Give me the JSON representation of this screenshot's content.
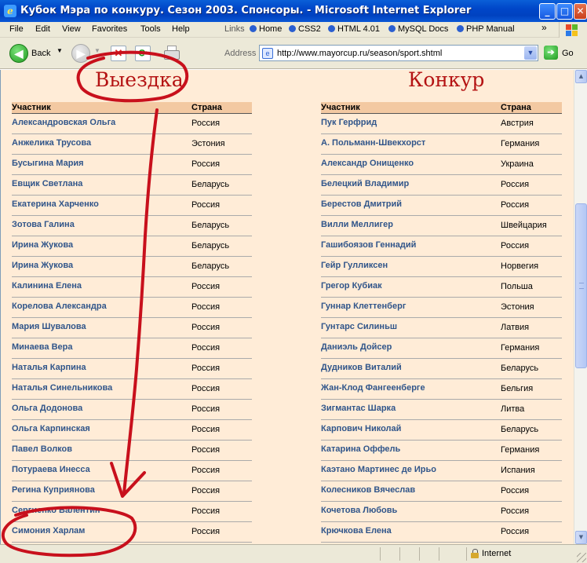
{
  "window": {
    "title": "Кубок Мэра по конкуру. Сезон 2003. Спонсоры. - Microsoft Internet Explorer"
  },
  "menubar": {
    "items": [
      "File",
      "Edit",
      "View",
      "Favorites",
      "Tools",
      "Help"
    ],
    "links_label": "Links",
    "links": [
      "Home",
      "CSS2",
      "HTML 4.01",
      "MySQL Docs",
      "PHP Manual"
    ]
  },
  "toolbar": {
    "back_label": "Back",
    "address_label": "Address",
    "address_value": "http://www.mayorcup.ru/season/sport.shtml",
    "go_label": "Go"
  },
  "icons": {
    "back": "back-arrow-icon",
    "forward": "forward-arrow-icon",
    "stop": "stop-icon",
    "refresh": "refresh-icon",
    "print": "printer-icon",
    "go": "go-arrow-icon",
    "zone": "lock-icon"
  },
  "colors": {
    "page_background": "#ffecd7",
    "table_header": "#f3c9a2",
    "name_link": "#30558a",
    "heading": "#b41313",
    "annotation": "#c8101c",
    "titlebar": "#0046c8"
  },
  "content": {
    "dressage": {
      "heading": "Выездка",
      "col_participant": "Участник",
      "col_country": "Страна",
      "rows": [
        {
          "name": "Александровская Ольга",
          "country": "Россия"
        },
        {
          "name": "Анжелика Трусова",
          "country": "Эстония"
        },
        {
          "name": "Бусыгина Мария",
          "country": "Россия"
        },
        {
          "name": "Евщик Светлана",
          "country": "Беларусь"
        },
        {
          "name": "Екатерина Харченко",
          "country": "Россия"
        },
        {
          "name": "Зотова Галина",
          "country": "Беларусь"
        },
        {
          "name": "Ирина Жукова",
          "country": "Беларусь"
        },
        {
          "name": "Ирина Жукова",
          "country": "Беларусь"
        },
        {
          "name": "Калинина Елена",
          "country": "Россия"
        },
        {
          "name": "Корелова Александра",
          "country": "Россия"
        },
        {
          "name": "Мария Шувалова",
          "country": "Россия"
        },
        {
          "name": "Минаева Вера",
          "country": "Россия"
        },
        {
          "name": "Наталья Карпина",
          "country": "Россия"
        },
        {
          "name": "Наталья Синельникова",
          "country": "Россия"
        },
        {
          "name": "Ольга Додонова",
          "country": "Россия"
        },
        {
          "name": "Ольга Карпинская",
          "country": "Россия"
        },
        {
          "name": "Павел Волков",
          "country": "Россия"
        },
        {
          "name": "Потураева Инесса",
          "country": "Россия"
        },
        {
          "name": "Регина Куприянова",
          "country": "Россия"
        },
        {
          "name": "Сергиенко Валентин",
          "country": "Россия"
        },
        {
          "name": "Симония Харлам",
          "country": "Россия"
        }
      ]
    },
    "jumping": {
      "heading": "Конкур",
      "col_participant": "Участник",
      "col_country": "Страна",
      "rows": [
        {
          "name": "Пук Герфрид",
          "country": "Австрия"
        },
        {
          "name": "А. Польманн-Швекхорст",
          "country": "Германия"
        },
        {
          "name": "Александр Онищенко",
          "country": "Украина"
        },
        {
          "name": "Белецкий Владимир",
          "country": "Россия"
        },
        {
          "name": "Берестов Дмитрий",
          "country": "Россия"
        },
        {
          "name": "Вилли Меллигер",
          "country": "Швейцария"
        },
        {
          "name": "Гашибоязов Геннадий",
          "country": "Россия"
        },
        {
          "name": "Гейр Гулликсен",
          "country": "Норвегия"
        },
        {
          "name": "Грегор Кубиак",
          "country": "Польша"
        },
        {
          "name": "Гуннар Клеттенберг",
          "country": "Эстония"
        },
        {
          "name": "Гунтарс Силиньш",
          "country": "Латвия"
        },
        {
          "name": "Даниэль Дойсер",
          "country": "Германия"
        },
        {
          "name": "Дудников Виталий",
          "country": "Беларусь"
        },
        {
          "name": "Жан-Клод Фангеенберге",
          "country": "Бельгия"
        },
        {
          "name": "Зигмантас Шарка",
          "country": "Литва"
        },
        {
          "name": "Карпович Николай",
          "country": "Беларусь"
        },
        {
          "name": "Катарина Оффель",
          "country": "Германия"
        },
        {
          "name": "Каэтано Мартинес де Ирьо",
          "country": "Испания"
        },
        {
          "name": "Колесников Вячеслав",
          "country": "Россия"
        },
        {
          "name": "Кочетова Любовь",
          "country": "Россия"
        },
        {
          "name": "Крючкова Елена",
          "country": "Россия"
        }
      ]
    }
  },
  "statusbar": {
    "zone": "Internet"
  }
}
